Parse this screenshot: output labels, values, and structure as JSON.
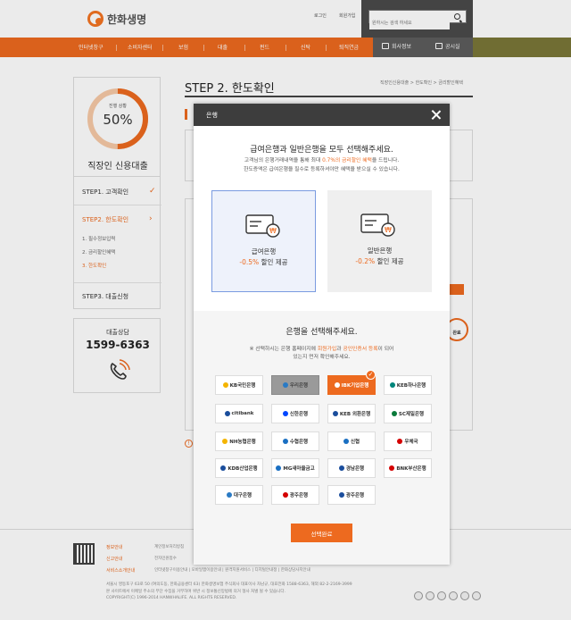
{
  "header": {
    "logo_text": "한화생명",
    "login": "로그인",
    "join": "회원가입",
    "search_placeholder": "원하시는 검색 하세요"
  },
  "nav": {
    "items": [
      "인터넷창구",
      "소비자센터",
      "보험",
      "대출",
      "펀드",
      "신탁",
      "퇴직연금"
    ],
    "right_items": [
      "회사정보",
      "공시실"
    ]
  },
  "sidebar": {
    "progress_label": "진행 상황",
    "progress_value": "50%",
    "progress_fraction": 0.5,
    "title": "직장인 신용대출",
    "step1": "STEP1. 고객확인",
    "step2": "STEP2. 한도확인",
    "sub_steps": [
      "1. 필수정보입력",
      "2. 금리할인혜택",
      "3. 한도확인"
    ],
    "step3": "STEP3. 대출신청",
    "contact_label": "대출상담",
    "contact_phone": "1599-6363"
  },
  "main": {
    "step_title": "STEP 2. 한도확인",
    "breadcrumb": "직장인신용대출 > 한도확인 > 금리할인혜택"
  },
  "modal": {
    "title": "은행",
    "question1": "급여은행과 일반은행을 모두 선택해주세요.",
    "desc1_pre": "고객님의 은행거래내역을 통해 최대 ",
    "desc1_highlight": "0.7%의 금리할인 혜택",
    "desc1_post": "을 드립니다.",
    "desc1_line2": "한도증액은 급여은행을 필수로 등록하셔야만 혜택을 받으실 수 있습니다.",
    "choices": [
      {
        "name": "급여은행",
        "rate": "-0.5%",
        "suffix": " 할인 제공"
      },
      {
        "name": "일반은행",
        "rate": "-0.2%",
        "suffix": " 할인 제공"
      }
    ],
    "question2": "은행을 선택해주세요.",
    "desc2_pre": "※ 선택하시는 은행 홈페이지에 ",
    "desc2_hl1": "회원가입",
    "desc2_mid": "과 ",
    "desc2_hl2": "공인인증서 등록",
    "desc2_post": "이 되어",
    "desc2_line2": "있는지 먼저 확인해주세요.",
    "banks": [
      "KB국민은행",
      "우리은행",
      "IBK기업은행",
      "KEB하나은행",
      "citibank",
      "신한은행",
      "KEB 외환은행",
      "SC제일은행",
      "NH농협은행",
      "수협은행",
      "신협",
      "우체국",
      "KDB산업은행",
      "MG새마을금고",
      "경남은행",
      "BNK부산은행",
      "대구은행",
      "광주은행",
      "광주은행"
    ],
    "bank_colors": [
      "#f4b400",
      "#2a7ac4",
      "#ffffff",
      "#00857a",
      "#1a4d9c",
      "#0046ff",
      "#1a4d9c",
      "#0a7a3a",
      "#f4b400",
      "#1a6fc2",
      "#1a6fc2",
      "#d40000",
      "#1a4d9c",
      "#1a6fc2",
      "#1a4d9c",
      "#d40000",
      "#2a7ac4",
      "#d40000",
      "#1a4d9c"
    ],
    "confirm": "선택완료"
  },
  "bg": {
    "done_label": "완료"
  },
  "footer": {
    "links": [
      "정보안내",
      "신고안내",
      "서비스소개안내"
    ],
    "row1": "계인정보처리방침",
    "row2": "전자민원접수",
    "row3": "인터넷창구이용안내 | 모바일앱이용안내 | 원격지원서비스 | 디지털안내정 | 한화상담사지안내",
    "address": "서울시 영등포구 63로 50 (여의도동, 한화금융센터 63) 한화생명보험 주식회사 대표이사 차남규, 대표전화 1588-6363, 해외 82-2-2169-3999",
    "notice": "본 사이트에서 이메일 주소의 무단 수집을 거부하며 위반 시 정보통신망법에 의거 형사 처벌 될 수 있습니다.",
    "copyright": "COPYRIGHT(C) 1996-2014 HANWHALIFE. ALL RIGHTS RESERVED."
  },
  "colors": {
    "accent": "#ed6a1f",
    "header_dark": "#4a4a4a"
  }
}
